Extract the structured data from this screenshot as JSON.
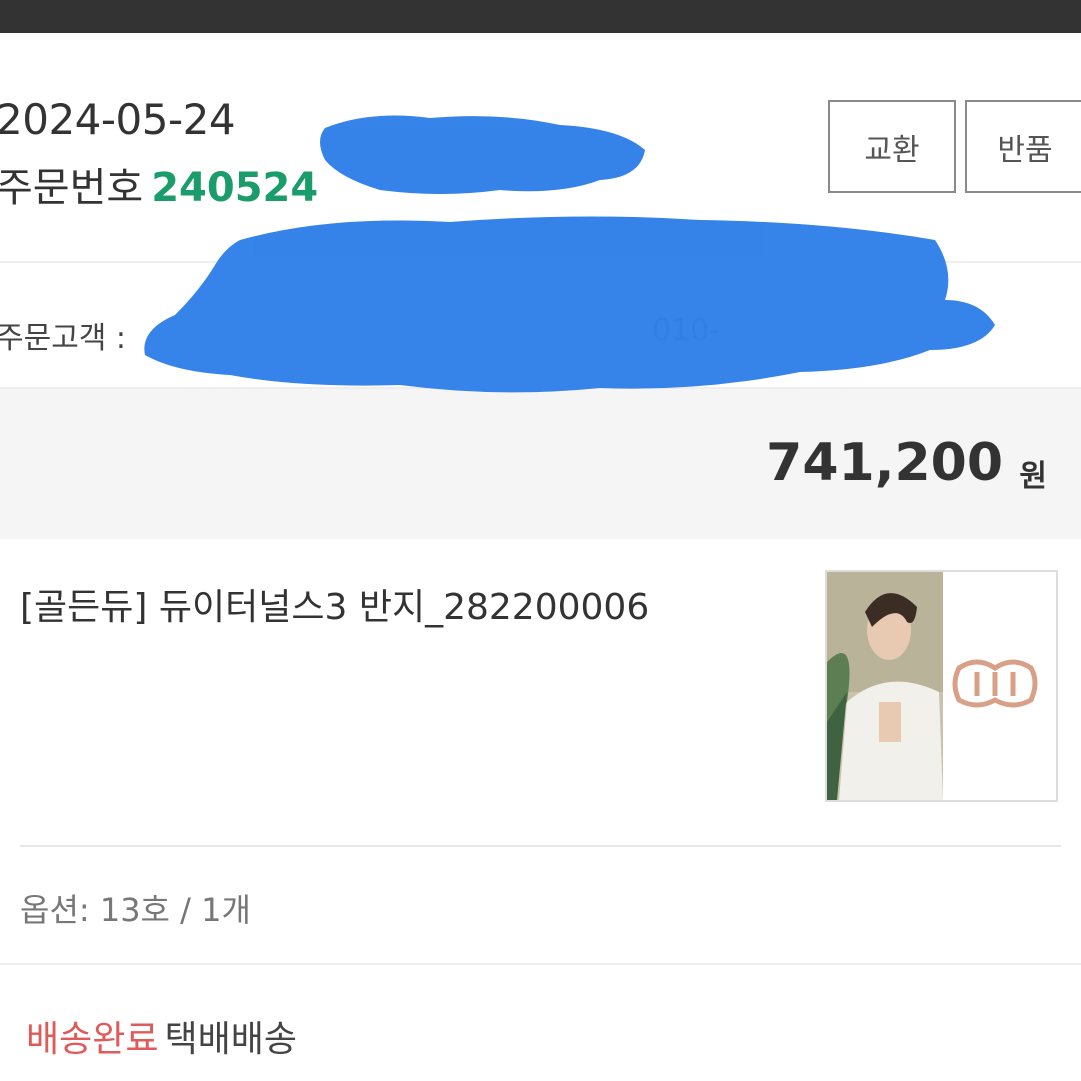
{
  "order": {
    "date": "2024-05-24",
    "number_label": "주문번호",
    "number_value": "240524",
    "exchange_label": "교환",
    "return_label": "반품"
  },
  "customer": {
    "label": "주문고객 :",
    "phone_fragment": "010-"
  },
  "total": {
    "amount": "741,200",
    "unit": "원"
  },
  "product": {
    "name": "[골든듀] 듀이터널스3 반지_282200006",
    "option": "옵션: 13호  / 1개"
  },
  "delivery": {
    "status": "배송완료",
    "method": "택배배송"
  },
  "colors": {
    "accent_green": "#1a9c6b",
    "status_red": "#e05a5a",
    "redaction_blue": "#2f7fe8"
  }
}
